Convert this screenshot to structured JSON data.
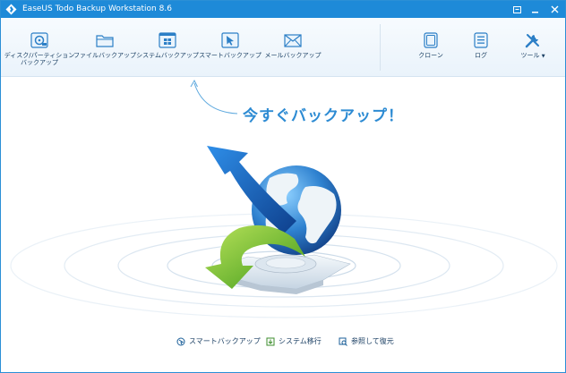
{
  "window": {
    "title": "EaseUS Todo Backup Workstation 8.6",
    "controls": {
      "minimize": "–",
      "maximize": "□",
      "close": "✕"
    }
  },
  "toolbar": {
    "items": [
      {
        "label_line1": "ディスク/パーティション",
        "label_line2": "バックアップ",
        "icon": "disk-backup-icon"
      },
      {
        "label_line1": "ファイルバックアップ",
        "icon": "folder-icon"
      },
      {
        "label_line1": "システムバックアップ",
        "icon": "windows-icon"
      },
      {
        "label_line1": "スマートバックアップ",
        "icon": "cursor-icon"
      },
      {
        "label_line1": "メールバックアップ",
        "icon": "mail-icon"
      }
    ],
    "right_items": [
      {
        "label": "クローン",
        "icon": "clone-icon"
      },
      {
        "label": "ログ",
        "icon": "log-icon"
      },
      {
        "label": "ツール",
        "icon": "tools-icon"
      }
    ]
  },
  "main": {
    "hint": "今すぐバックアップ！"
  },
  "bottom_links": [
    {
      "label": "スマートバックアップ",
      "icon": "smart-backup-icon"
    },
    {
      "label": "システム移行",
      "icon": "system-transfer-icon"
    },
    {
      "label": "参照して復元",
      "icon": "browse-restore-icon"
    }
  ],
  "colors": {
    "titlebar": "#1e8ad8",
    "accent": "#2d8bd3",
    "label": "#1b3f63"
  }
}
